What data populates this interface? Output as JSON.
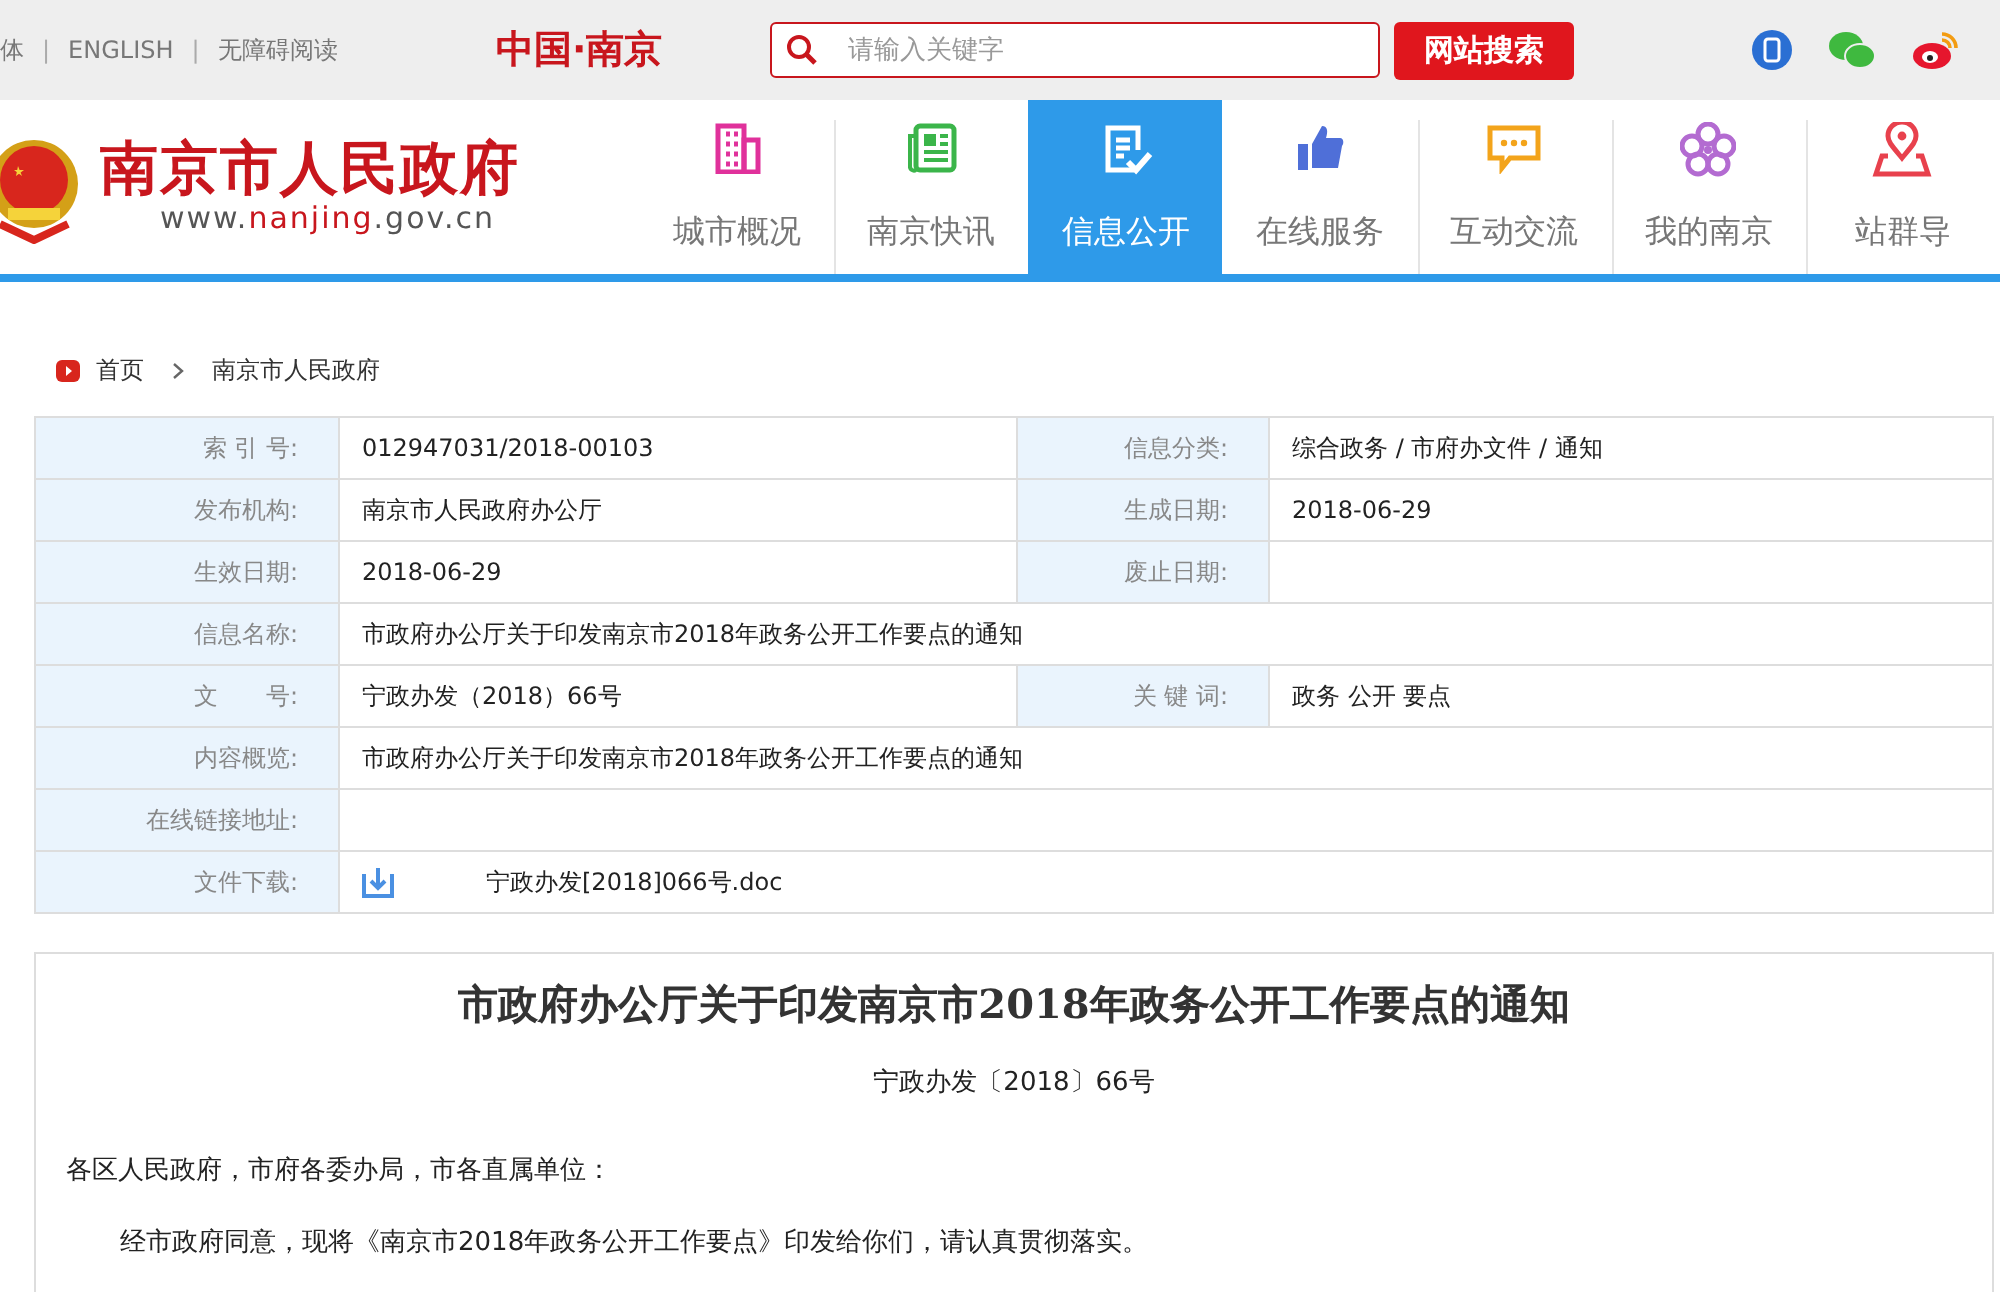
{
  "top_bar": {
    "links": [
      "体",
      "ENGLISH",
      "无障碍阅读"
    ],
    "separators": [
      "|",
      "|"
    ],
    "brand": "中国·南京",
    "search": {
      "placeholder": "请输入关键字",
      "button": "网站搜索"
    }
  },
  "header": {
    "site_name": "南京市人民政府",
    "site_url_prefix": "www.",
    "site_url_domain": "nanjing",
    "site_url_suffix": ".gov.cn",
    "nav": [
      {
        "label": "城市概况",
        "selected": false
      },
      {
        "label": "南京快讯",
        "selected": false
      },
      {
        "label": "信息公开",
        "selected": true
      },
      {
        "label": "在线服务",
        "selected": false
      },
      {
        "label": "互动交流",
        "selected": false
      },
      {
        "label": "我的南京",
        "selected": false
      },
      {
        "label": "站群导",
        "selected": false
      }
    ]
  },
  "breadcrumb": [
    "首页",
    "南京市人民政府"
  ],
  "info_table": {
    "rows": [
      {
        "fields": [
          {
            "label": "索 引 号:",
            "value": "012947031/2018-00103",
            "kind": "text"
          },
          {
            "label": "信息分类:",
            "value": "综合政务 / 市府办文件 / 通知",
            "kind": "text"
          }
        ]
      },
      {
        "fields": [
          {
            "label": "发布机构:",
            "value": "南京市人民政府办公厅",
            "kind": "text"
          },
          {
            "label": "生成日期:",
            "value": "2018-06-29",
            "kind": "text"
          }
        ]
      },
      {
        "fields": [
          {
            "label": "生效日期:",
            "value": "2018-06-29",
            "kind": "text"
          },
          {
            "label": "废止日期:",
            "kind": "text"
          }
        ]
      },
      {
        "fields": [
          {
            "label": "信息名称:",
            "value": "市政府办公厅关于印发南京市2018年政务公开工作要点的通知",
            "kind": "text"
          }
        ]
      },
      {
        "fields": [
          {
            "label": "文　　号:",
            "value": "宁政办发（2018）66号",
            "kind": "text"
          },
          {
            "label": "关 键 词:",
            "value": "政务 公开 要点",
            "kind": "text"
          }
        ]
      },
      {
        "fields": [
          {
            "label": "内容概览:",
            "value": "市政府办公厅关于印发南京市2018年政务公开工作要点的通知",
            "kind": "text"
          }
        ]
      },
      {
        "fields": [
          {
            "label": "在线链接地址:",
            "kind": "text"
          }
        ]
      },
      {
        "fields": [
          {
            "label": "文件下载:",
            "value": "宁政办发[2018]066号.doc",
            "kind": "file"
          }
        ]
      }
    ]
  },
  "article": {
    "title": "市政府办公厅关于印发南京市2018年政务公开工作要点的通知",
    "doc_number": "宁政办发〔2018〕66号",
    "salutation": "各区人民政府，市府各委办局，市各直属单位：",
    "paragraphs": [
      "经市政府同意，现将《南京市2018年政务公开工作要点》印发给你们，请认真贯彻落实。"
    ]
  }
}
